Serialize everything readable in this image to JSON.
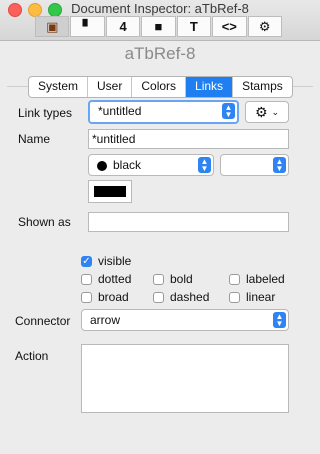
{
  "window": {
    "title": "Document Inspector: aTbRef-8"
  },
  "toolbar": {
    "items": [
      {
        "icon": "document-settings-icon",
        "glyph": "▣"
      },
      {
        "icon": "note-icon",
        "glyph": "▘"
      },
      {
        "icon": "number-4-icon",
        "glyph": "4"
      },
      {
        "icon": "shadow-box-icon",
        "glyph": "■"
      },
      {
        "icon": "text-T-icon",
        "glyph": "T"
      },
      {
        "icon": "code-brackets-icon",
        "glyph": "<>"
      },
      {
        "icon": "gear-icon",
        "glyph": "⚙"
      }
    ]
  },
  "doc_name": "aTbRef-8",
  "tabs": [
    "System",
    "User",
    "Colors",
    "Links",
    "Stamps"
  ],
  "active_tab": "Links",
  "form": {
    "link_types_label": "Link types",
    "link_types_value": "*untitled",
    "name_label": "Name",
    "name_value": "*untitled",
    "color_value": "black",
    "color2_value": "",
    "shown_as_label": "Shown as",
    "shown_as_value": "",
    "connector_label": "Connector",
    "connector_value": "arrow",
    "action_label": "Action",
    "action_value": ""
  },
  "checkboxes": [
    {
      "label": "visible",
      "checked": true
    },
    {
      "label": "dotted",
      "checked": false
    },
    {
      "label": "bold",
      "checked": false
    },
    {
      "label": "labeled",
      "checked": false
    },
    {
      "label": "broad",
      "checked": false
    },
    {
      "label": "dashed",
      "checked": false
    },
    {
      "label": "linear",
      "checked": false
    }
  ],
  "colors": {
    "accent": "#2f84f3",
    "swatch": "#000000"
  }
}
